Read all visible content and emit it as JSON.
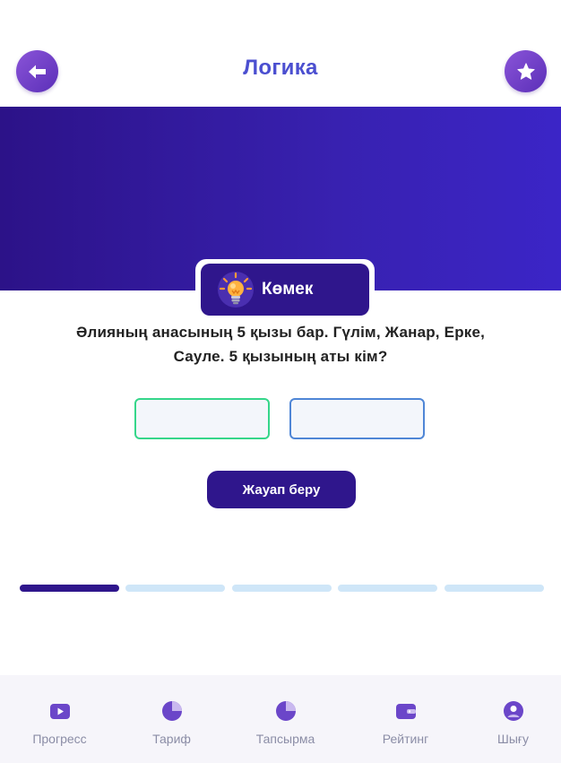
{
  "header": {
    "title": "Логика"
  },
  "help": {
    "label": "Көмек"
  },
  "question": {
    "text": "Әлияның анасының 5 қызы бар. Гүлім, Жанар, Ерке, Сауле. 5 қызының аты кім?"
  },
  "answer_fields": [
    {
      "value": "",
      "placeholder": ""
    },
    {
      "value": "",
      "placeholder": ""
    }
  ],
  "submit": {
    "label": "Жауап беру"
  },
  "progress": {
    "current": 1,
    "total": 5
  },
  "nav": [
    {
      "label": "Прогресс",
      "icon": "play-icon"
    },
    {
      "label": "Тариф",
      "icon": "pie-chart-icon"
    },
    {
      "label": "Тапсырма",
      "icon": "pie-chart-icon"
    },
    {
      "label": "Рейтинг",
      "icon": "wallet-icon"
    },
    {
      "label": "Шығу",
      "icon": "user-icon"
    }
  ],
  "colors": {
    "accent": "#2f168c",
    "title": "#4b4fd0",
    "banner_start": "#2c1288",
    "banner_end": "#3b25c7",
    "progress_inactive": "#cfe6f8",
    "nav_icon": "#6b46c9"
  }
}
